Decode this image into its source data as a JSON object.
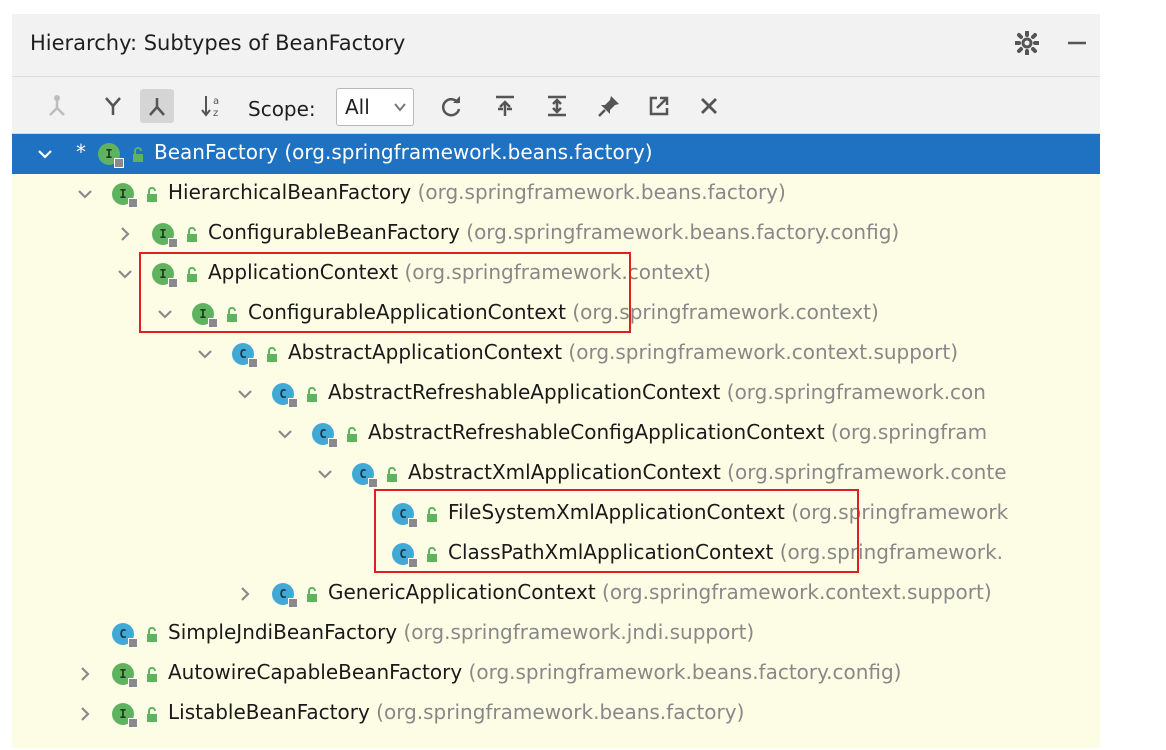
{
  "window": {
    "title": "Hierarchy:  Subtypes of BeanFactory",
    "icons": [
      "gear-icon",
      "minimize-icon"
    ]
  },
  "toolbar": {
    "buttons": [
      "supertypes-hierarchy-icon",
      "subtypes-hierarchy-icon",
      "class-hierarchy-icon",
      "sort-alphabetically-icon",
      "refresh-icon",
      "autoscroll-to-source-icon",
      "expand-all-icon",
      "pin-icon",
      "export-icon",
      "close-icon"
    ],
    "scope_label": "Scope:",
    "scope_value": "All"
  },
  "tree": {
    "rows": [
      {
        "name": "BeanFactory",
        "pkg": "(org.springframework.beans.factory)",
        "kind": "I",
        "expanded": true,
        "selected": true,
        "star": "*"
      },
      {
        "name": "HierarchicalBeanFactory",
        "pkg": "(org.springframework.beans.factory)",
        "kind": "I",
        "expanded": true
      },
      {
        "name": "ConfigurableBeanFactory",
        "pkg": "(org.springframework.beans.factory.config)",
        "kind": "I",
        "expanded": false
      },
      {
        "name": "ApplicationContext",
        "pkg": "(org.springframework.context)",
        "kind": "I",
        "expanded": true
      },
      {
        "name": "ConfigurableApplicationContext",
        "pkg": "(org.springframework.context)",
        "kind": "I",
        "expanded": true
      },
      {
        "name": "AbstractApplicationContext",
        "pkg": "(org.springframework.context.support)",
        "kind": "C",
        "expanded": true
      },
      {
        "name": "AbstractRefreshableApplicationContext",
        "pkg": "(org.springframework.con",
        "kind": "C",
        "expanded": true
      },
      {
        "name": "AbstractRefreshableConfigApplicationContext",
        "pkg": "(org.springfram",
        "kind": "C",
        "expanded": true
      },
      {
        "name": "AbstractXmlApplicationContext",
        "pkg": "(org.springframework.conte",
        "kind": "C",
        "expanded": true
      },
      {
        "name": "FileSystemXmlApplicationContext",
        "pkg": "(org.springframework",
        "kind": "C"
      },
      {
        "name": "ClassPathXmlApplicationContext",
        "pkg": "(org.springframework.",
        "kind": "C"
      },
      {
        "name": "GenericApplicationContext",
        "pkg": "(org.springframework.context.support)",
        "kind": "C",
        "expanded": false
      },
      {
        "name": "SimpleJndiBeanFactory",
        "pkg": "(org.springframework.jndi.support)",
        "kind": "C"
      },
      {
        "name": "AutowireCapableBeanFactory",
        "pkg": "(org.springframework.beans.factory.config)",
        "kind": "I",
        "expanded": false
      },
      {
        "name": "ListableBeanFactory",
        "pkg": "(org.springframework.beans.factory)",
        "kind": "I",
        "expanded": false
      }
    ]
  },
  "colors": {
    "selection": "#1f71c2",
    "tree_background": "#fdfde6",
    "highlight_box": "#e02020",
    "interface_badge": "#5fb35f",
    "class_badge": "#41a9d6",
    "package_text": "#888888"
  }
}
